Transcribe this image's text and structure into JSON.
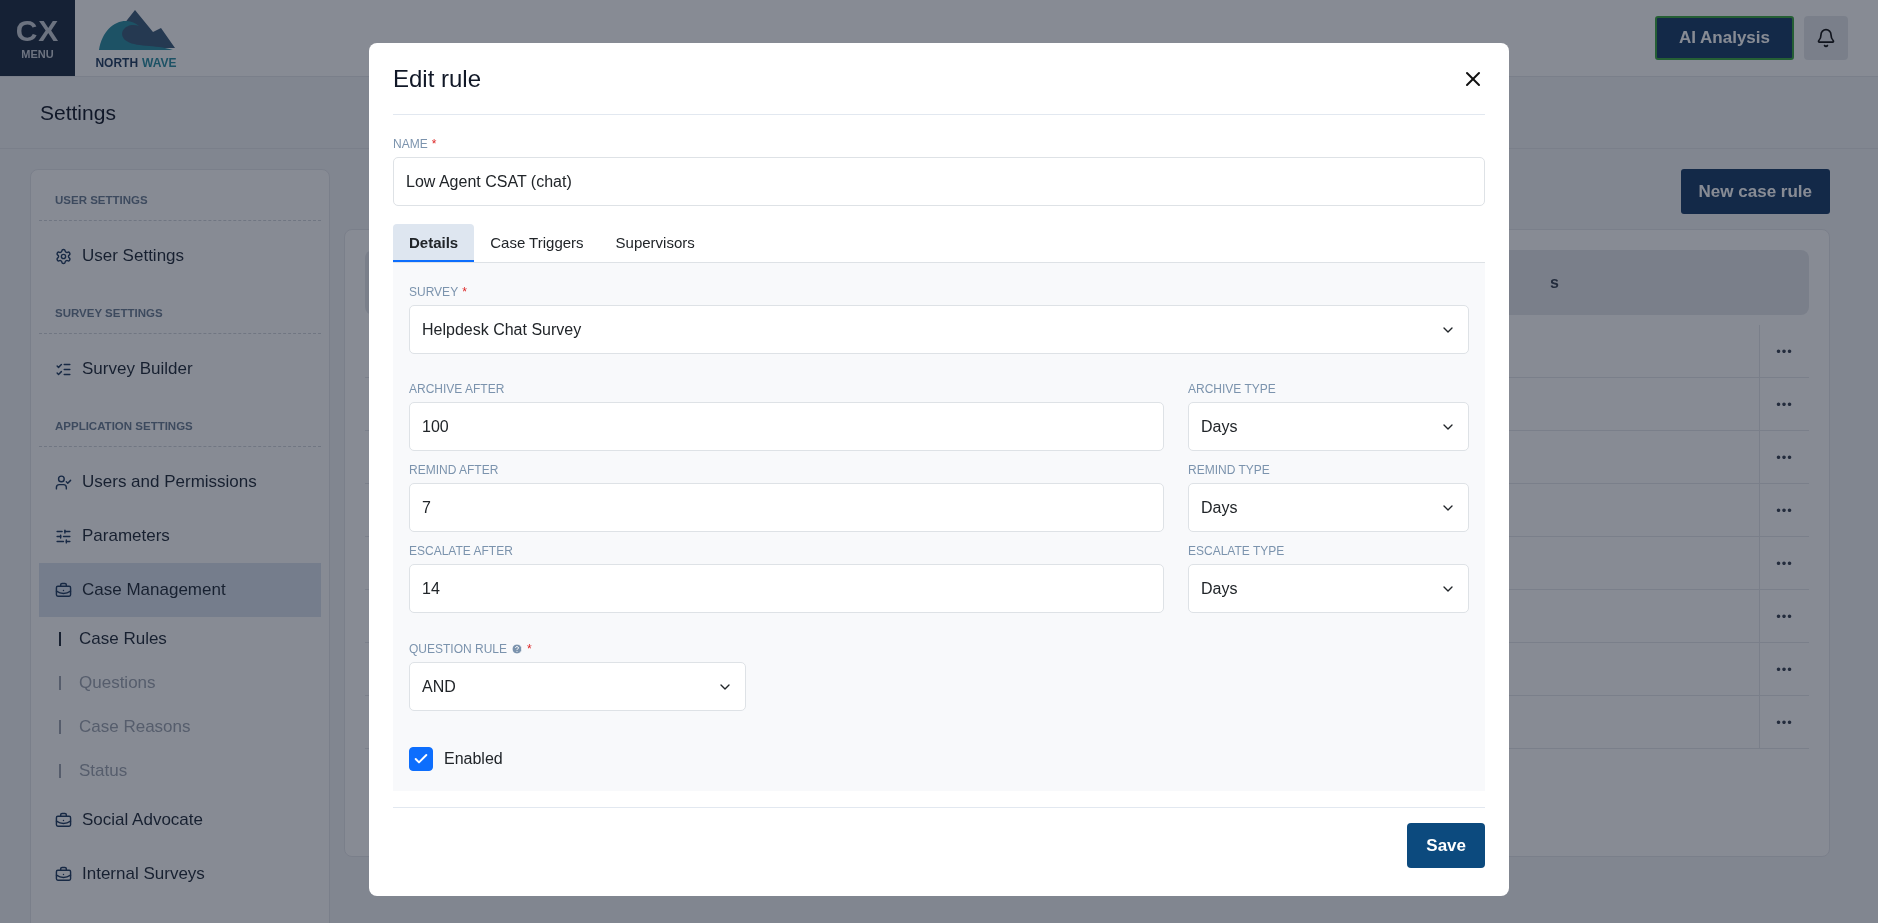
{
  "header": {
    "logo_mark": "CX",
    "logo_caption": "MENU",
    "brand_words": [
      "NORTH",
      "WAVE"
    ],
    "ai_button": "AI Analysis"
  },
  "page_title": "Settings",
  "sidebar": {
    "sections": [
      {
        "heading": "USER SETTINGS",
        "items": [
          {
            "label": "User Settings",
            "selected": false
          }
        ]
      },
      {
        "heading": "SURVEY SETTINGS",
        "items": [
          {
            "label": "Survey Builder",
            "selected": false
          }
        ]
      },
      {
        "heading": "APPLICATION SETTINGS",
        "items": [
          {
            "label": "Users and Permissions",
            "selected": false
          },
          {
            "label": "Parameters",
            "selected": false
          },
          {
            "label": "Case Management",
            "selected": true,
            "children": [
              {
                "label": "Case Rules",
                "selected": true
              },
              {
                "label": "Questions",
                "selected": false
              },
              {
                "label": "Case Reasons",
                "selected": false
              },
              {
                "label": "Status",
                "selected": false
              }
            ]
          },
          {
            "label": "Social Advocate",
            "selected": false
          },
          {
            "label": "Internal Surveys",
            "selected": false
          }
        ]
      }
    ]
  },
  "new_button": "New case rule",
  "table": {
    "column_heading": "s",
    "row_actions": [
      "•••",
      "•••",
      "•••",
      "•••",
      "•••",
      "•••",
      "•••",
      "•••"
    ]
  },
  "modal": {
    "title": "Edit rule",
    "name_field": {
      "label": "NAME",
      "required_mark": "*",
      "value": "Low Agent CSAT (chat)"
    },
    "tabs": [
      {
        "label": "Details",
        "selected": true
      },
      {
        "label": "Case Triggers",
        "selected": false
      },
      {
        "label": "Supervisors",
        "selected": false
      }
    ],
    "survey": {
      "label": "SURVEY",
      "required_mark": "*",
      "kind": "select",
      "value": "Helpdesk Chat Survey"
    },
    "rows": [
      [
        {
          "label": "ARCHIVE AFTER",
          "kind": "input",
          "value": "100"
        },
        {
          "label": "ARCHIVE TYPE",
          "kind": "select",
          "value": "Days"
        }
      ],
      [
        {
          "label": "REMIND AFTER",
          "kind": "input",
          "value": "7"
        },
        {
          "label": "REMIND TYPE",
          "kind": "select",
          "value": "Days"
        }
      ],
      [
        {
          "label": "ESCALATE AFTER",
          "kind": "input",
          "value": "14"
        },
        {
          "label": "ESCALATE TYPE",
          "kind": "select",
          "value": "Days"
        }
      ]
    ],
    "question_rule": {
      "label": "QUESTION RULE",
      "required_mark": "*",
      "help": true,
      "kind": "select",
      "value": "AND"
    },
    "enabled": {
      "label": "Enabled",
      "checked": true
    },
    "save": "Save"
  }
}
